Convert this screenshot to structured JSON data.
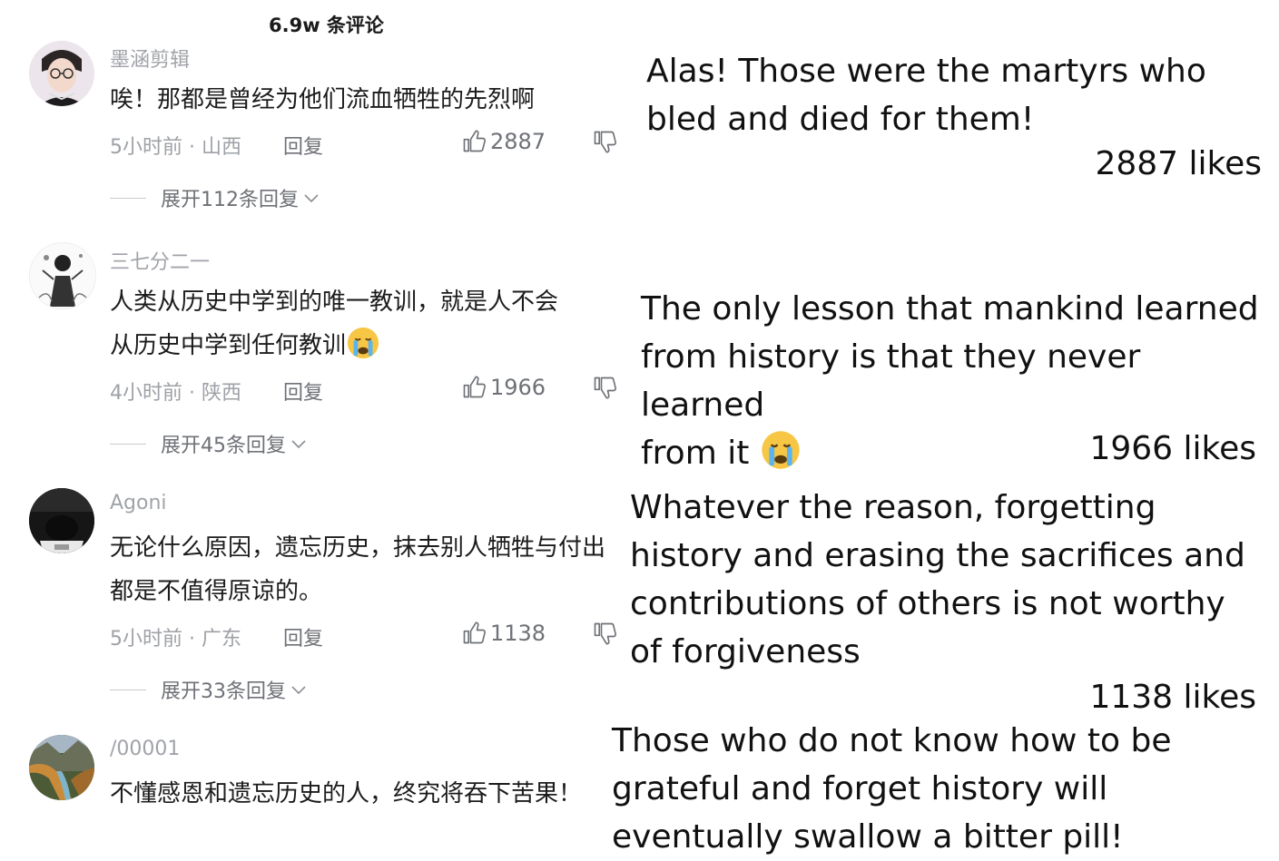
{
  "header": {
    "comment_count": "6.9w 条评论"
  },
  "comments": [
    {
      "username": "墨涵剪辑",
      "text": "唉！那都是曾经为他们流血牺牲的先烈啊",
      "time_location": "5小时前 · 山西",
      "reply_label": "回复",
      "likes": "2887",
      "expand_label": "展开112条回复",
      "translation": "Alas! Those were the martyrs who bled and died for them!",
      "likes_en": "2887 likes",
      "avatar_icon": "avatar-person-glasses"
    },
    {
      "username": "三七分二一",
      "text_line1": "人类从历史中学到的唯一教训，就是人不会",
      "text_line2": "从历史中学到任何教训",
      "time_location": "4小时前 · 陕西",
      "reply_label": "回复",
      "likes": "1966",
      "expand_label": "展开45条回复",
      "translation_line1": "The only lesson that mankind learned",
      "translation_line2": "from history is that they never learned",
      "translation_line3": "from it",
      "likes_en": "1966 likes",
      "avatar_icon": "avatar-sketch-figure",
      "emoji": "crying-face-emoji"
    },
    {
      "username": "Agoni",
      "text": "无论什么原因，遗忘历史，抹去别人牺牲与付出都是不值得原谅的。",
      "time_location": "5小时前 · 广东",
      "reply_label": "回复",
      "likes": "1138",
      "expand_label": "展开33条回复",
      "translation": "Whatever the reason, forgetting history and erasing the sacrifices and contributions of others is not worthy of forgiveness",
      "likes_en": "1138 likes",
      "avatar_icon": "avatar-dark-figure"
    },
    {
      "username": "/00001",
      "text": "不懂感恩和遗忘历史的人，终究将吞下苦果！",
      "translation": "Those who do not know how to be grateful and forget history will eventually swallow a bitter pill!",
      "avatar_icon": "avatar-river-landscape"
    }
  ],
  "colors": {
    "meta_gray": "#9ea1a6",
    "text_dark": "#1c1c1c",
    "divider": "#c9cbce"
  }
}
